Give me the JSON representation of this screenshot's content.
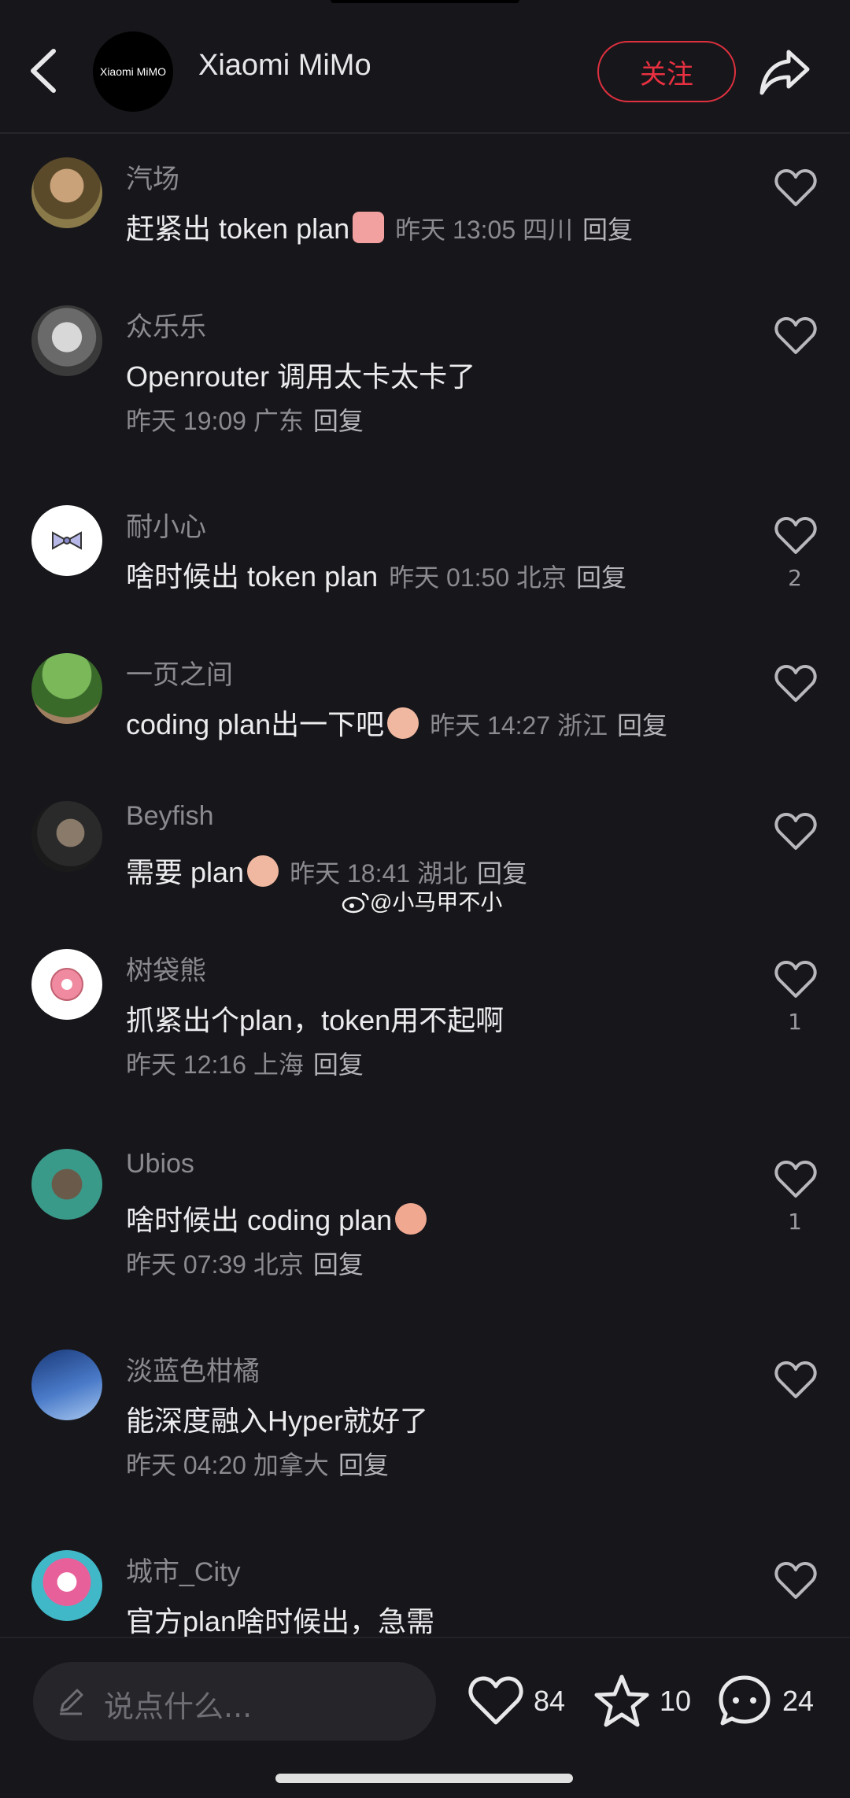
{
  "header": {
    "account_name": "Xiaomi MiMo",
    "logo_text": "Xiaomi MiMO",
    "follow_label": "关注"
  },
  "comments": [
    {
      "name": "汽场",
      "text": "赶紧出 token plan",
      "time": "昨天 13:05 四川",
      "reply": "回复",
      "likes": ""
    },
    {
      "name": "众乐乐",
      "text": "Openrouter 调用太卡太卡了",
      "time": "昨天 19:09 广东",
      "reply": "回复",
      "likes": ""
    },
    {
      "name": "耐小心",
      "text": "啥时候出 token plan",
      "time": "昨天 01:50 北京",
      "reply": "回复",
      "likes": "2"
    },
    {
      "name": "一页之间",
      "text": "coding plan出一下吧",
      "time": "昨天 14:27 浙江",
      "reply": "回复",
      "likes": ""
    },
    {
      "name": "Beyfish",
      "text": "需要 plan",
      "time": "昨天 18:41 湖北",
      "reply": "回复",
      "likes": ""
    },
    {
      "name": "树袋熊",
      "text": "抓紧出个plan，token用不起啊",
      "time": "昨天 12:16 上海",
      "reply": "回复",
      "likes": "1"
    },
    {
      "name": "Ubios",
      "text": "啥时候出 coding plan",
      "time": "昨天 07:39 北京",
      "reply": "回复",
      "likes": "1"
    },
    {
      "name": "淡蓝色柑橘",
      "text": "能深度融入Hyper就好了",
      "time": "昨天 04:20 加拿大",
      "reply": "回复",
      "likes": ""
    },
    {
      "name": "城市_City",
      "text": "官方plan啥时候出，急需",
      "time": "",
      "reply": "",
      "likes": ""
    }
  ],
  "watermark": "@小马甲不小",
  "bottom": {
    "input_placeholder": "说点什么...",
    "like_count": "84",
    "favorite_count": "10",
    "comment_count": "24"
  },
  "colors": {
    "background": "#17171b",
    "accent": "#e83040"
  },
  "icons": [
    "back-arrow-icon",
    "share-icon",
    "heart-icon",
    "star-icon",
    "comment-bubble-icon",
    "pen-icon",
    "weibo-icon"
  ]
}
